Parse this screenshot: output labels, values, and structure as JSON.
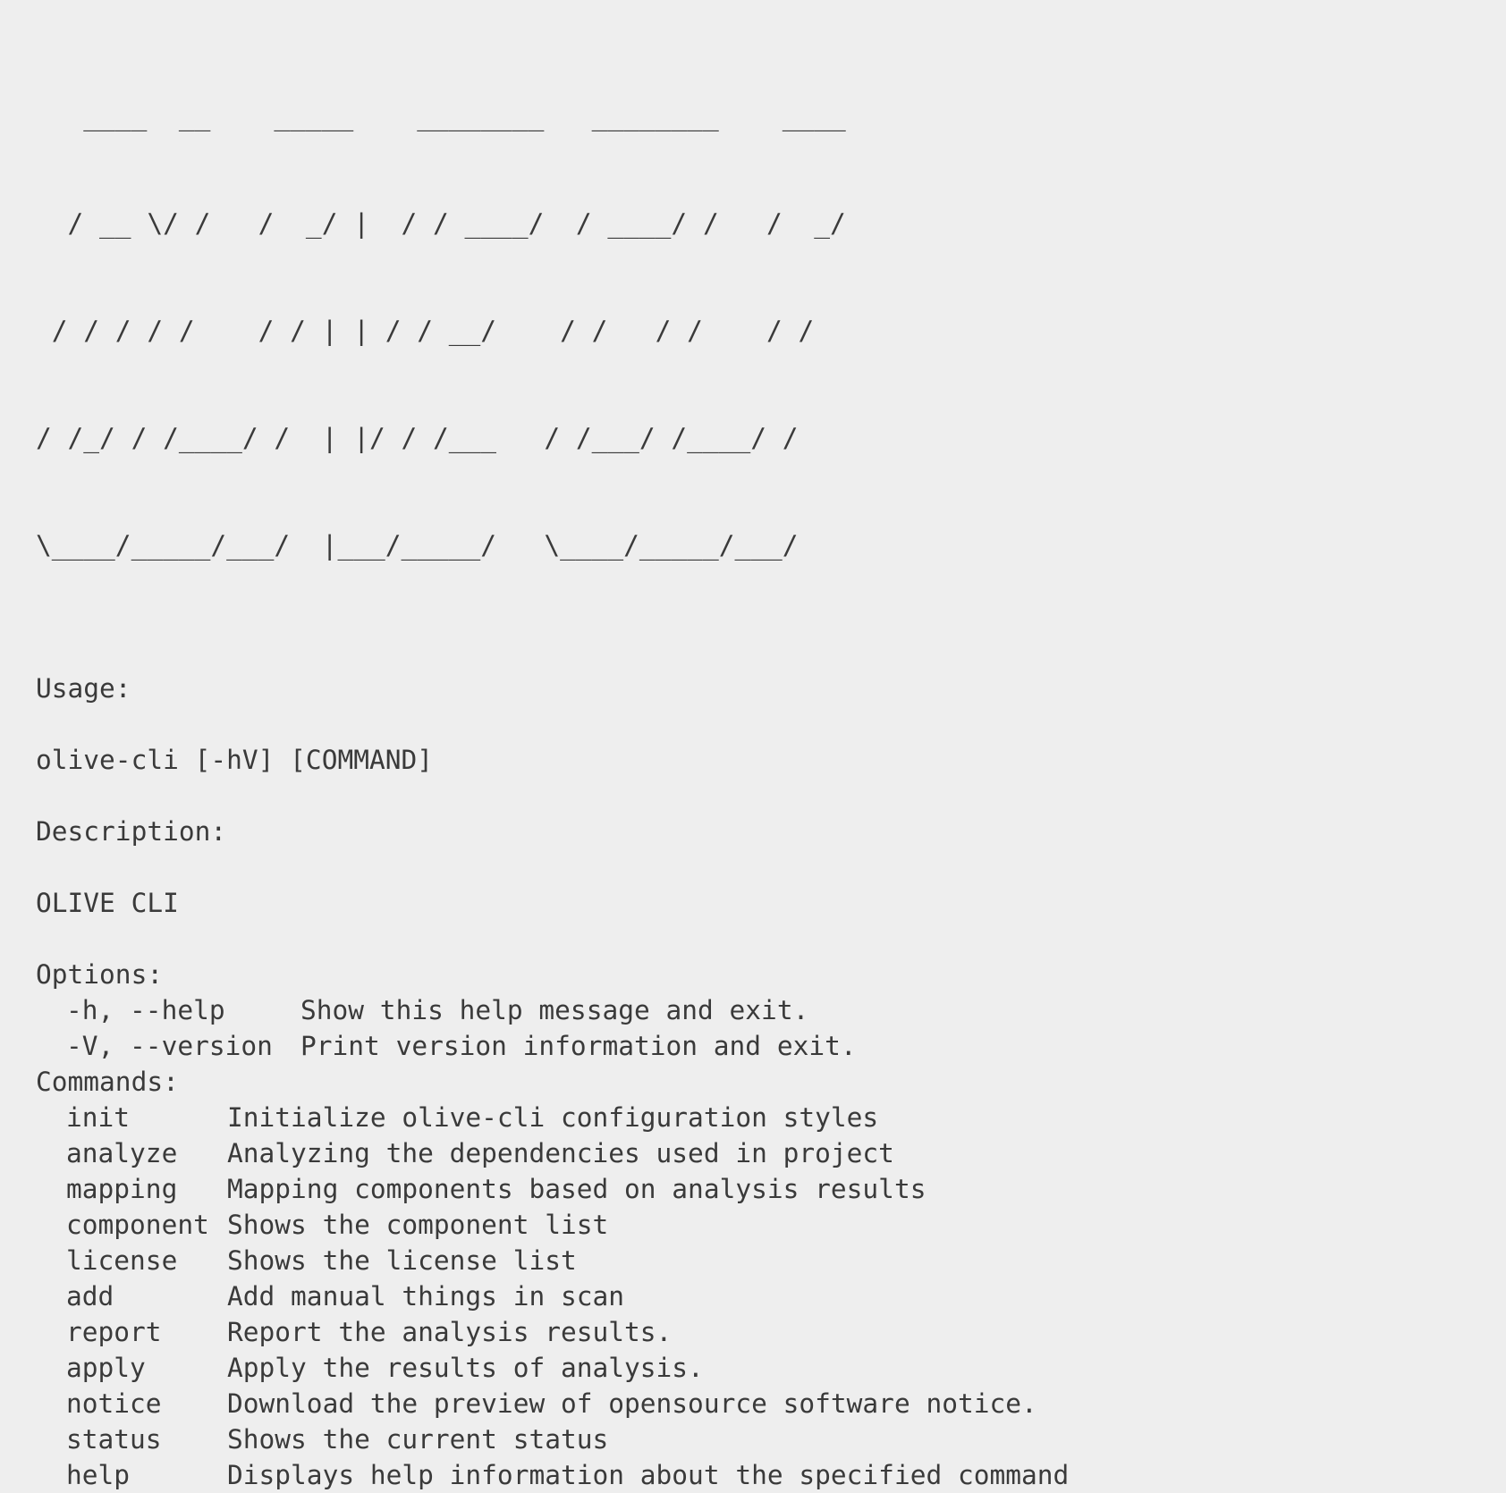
{
  "banner": {
    "lines": [
      "   ____  __    _____    ________   ________    ____",
      "  / __ \\/ /   /  _/ |  / / ____/  / ____/ /   /  _/",
      " / / / / /    / / | | / / __/    / /   / /    / /  ",
      "/ /_/ / /____/ /  | |/ / /___   / /___/ /____/ /   ",
      "\\____/_____/___/  |___/_____/   \\____/_____/___/   "
    ]
  },
  "usage": {
    "heading": "Usage:",
    "text": "olive-cli [-hV] [COMMAND]"
  },
  "description": {
    "heading": "Description:",
    "text": "OLIVE CLI"
  },
  "options": {
    "heading": "Options:",
    "items": [
      {
        "name": "-h, --help",
        "description": "Show this help message and exit."
      },
      {
        "name": "-V, --version",
        "description": "Print version information and exit."
      }
    ]
  },
  "commands": {
    "heading": "Commands:",
    "items": [
      {
        "name": "init",
        "description": "Initialize olive-cli configuration styles"
      },
      {
        "name": "analyze",
        "description": "Analyzing the dependencies used in project"
      },
      {
        "name": "mapping",
        "description": "Mapping components based on analysis results"
      },
      {
        "name": "component",
        "description": "Shows the component list"
      },
      {
        "name": "license",
        "description": "Shows the license list"
      },
      {
        "name": "add",
        "description": "Add manual things in scan"
      },
      {
        "name": "report",
        "description": "Report the analysis results."
      },
      {
        "name": "apply",
        "description": "Apply the results of analysis."
      },
      {
        "name": "notice",
        "description": "Download the preview of opensource software notice."
      },
      {
        "name": "status",
        "description": "Shows the current status"
      },
      {
        "name": "help",
        "description": "Displays help information about the specified command"
      }
    ]
  },
  "colors": {
    "background": "#eeeeee",
    "text": "#3a3a3a"
  }
}
